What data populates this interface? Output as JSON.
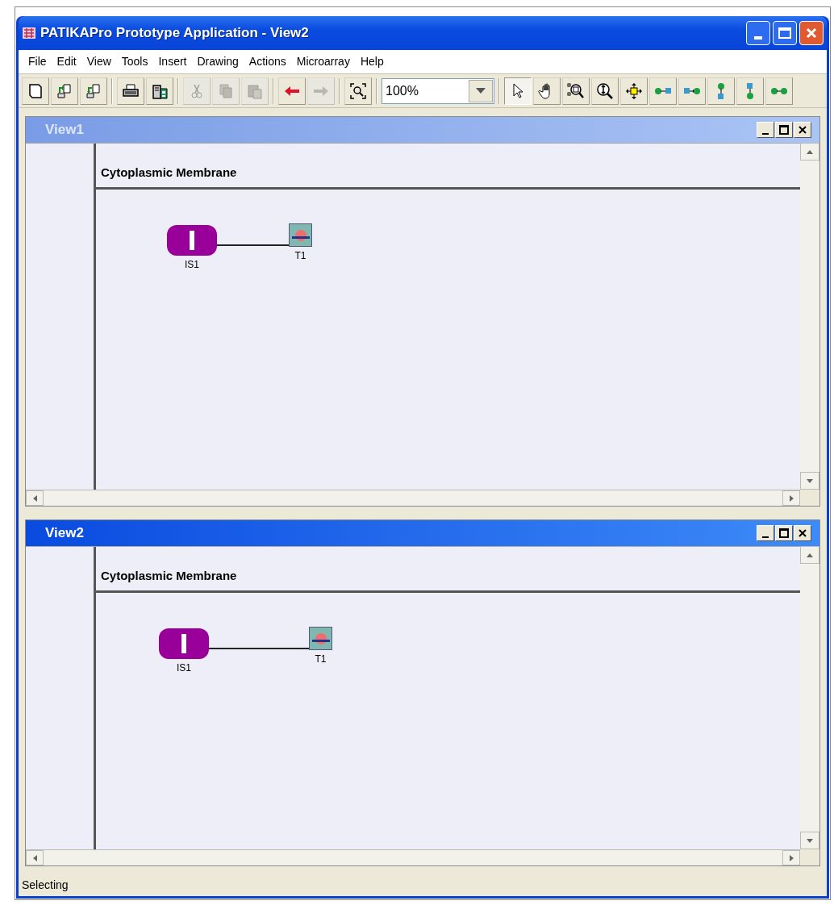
{
  "window": {
    "title": "PATIKAPro Prototype Application - View2"
  },
  "menu": [
    "File",
    "Edit",
    "View",
    "Tools",
    "Insert",
    "Drawing",
    "Actions",
    "Microarray",
    "Help"
  ],
  "toolbar": {
    "groups": [
      [
        {
          "kind": "new",
          "disabled": false
        },
        {
          "kind": "import",
          "disabled": false
        },
        {
          "kind": "export",
          "disabled": false
        }
      ],
      [
        {
          "kind": "print",
          "disabled": false
        },
        {
          "kind": "preview",
          "disabled": false
        }
      ],
      [
        {
          "kind": "cut",
          "disabled": true
        },
        {
          "kind": "copy",
          "disabled": true
        },
        {
          "kind": "paste",
          "disabled": true
        }
      ],
      [
        {
          "kind": "back",
          "disabled": false
        },
        {
          "kind": "forward",
          "disabled": true
        }
      ],
      [
        {
          "kind": "fit",
          "disabled": false
        }
      ]
    ],
    "zoom": "100%",
    "modes": [
      {
        "kind": "select",
        "selected": true
      },
      {
        "kind": "hand",
        "selected": false
      },
      {
        "kind": "zoombox",
        "selected": false
      },
      {
        "kind": "zoom",
        "selected": false
      },
      {
        "kind": "move",
        "selected": false
      },
      {
        "kind": "link_right",
        "selected": false
      },
      {
        "kind": "link_left",
        "selected": false
      },
      {
        "kind": "link_down",
        "selected": false
      },
      {
        "kind": "link_up",
        "selected": false
      },
      {
        "kind": "link",
        "selected": false
      }
    ]
  },
  "views": [
    {
      "title": "View1",
      "active": false,
      "compartment": "Cytoplasmic Membrane",
      "nodes": [
        {
          "kind": "state",
          "label": "IS1"
        },
        {
          "kind": "transition",
          "label": "T1"
        }
      ]
    },
    {
      "title": "View2",
      "active": true,
      "compartment": "Cytoplasmic Membrane",
      "nodes": [
        {
          "kind": "state",
          "label": "IS1"
        },
        {
          "kind": "transition",
          "label": "T1"
        }
      ]
    }
  ],
  "status_bar": "Selecting"
}
